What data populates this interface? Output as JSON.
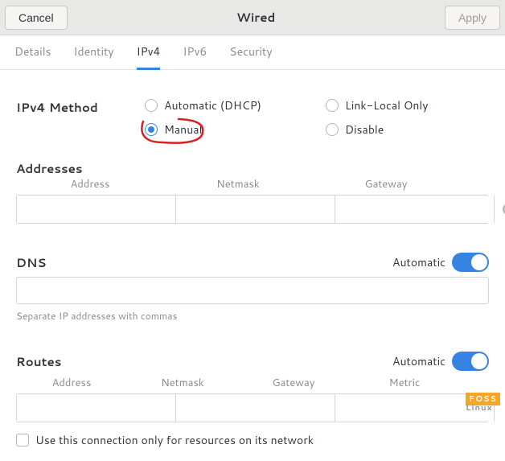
{
  "header": {
    "cancel": "Cancel",
    "title": "Wired",
    "apply": "Apply"
  },
  "tabs": {
    "details": "Details",
    "identity": "Identity",
    "ipv4": "IPv4",
    "ipv6": "IPv6",
    "security": "Security"
  },
  "method": {
    "label": "IPv4 Method",
    "auto": "Automatic (DHCP)",
    "link_local": "Link-Local Only",
    "manual": "Manual",
    "disable": "Disable",
    "selected": "manual"
  },
  "addresses": {
    "title": "Addresses",
    "cols": {
      "address": "Address",
      "netmask": "Netmask",
      "gateway": "Gateway"
    },
    "row": {
      "address": "",
      "netmask": "",
      "gateway": ""
    }
  },
  "dns": {
    "title": "DNS",
    "auto_label": "Automatic",
    "value": "",
    "hint": "Separate IP addresses with commas"
  },
  "routes": {
    "title": "Routes",
    "auto_label": "Automatic",
    "cols": {
      "address": "Address",
      "netmask": "Netmask",
      "gateway": "Gateway",
      "metric": "Metric"
    },
    "row": {
      "address": "",
      "netmask": "",
      "gateway": "",
      "metric": ""
    },
    "only_resources": "Use this connection only for resources on its network"
  },
  "watermark": {
    "top": "FOSS",
    "bottom": "Linux"
  }
}
